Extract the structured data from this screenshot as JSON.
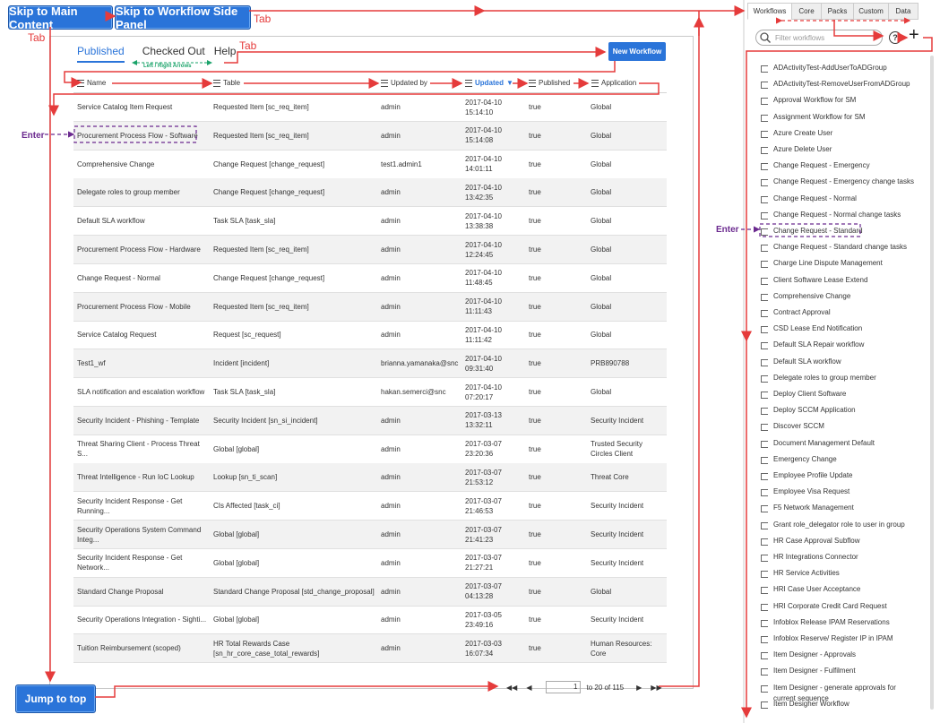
{
  "skip_links": {
    "main": "Skip to Main Content",
    "side": "Skip to Workflow Side Panel"
  },
  "annotations": {
    "tab": "Tab",
    "enter": "Enter",
    "arrows_hint": "Left / Right Arrows"
  },
  "left_tabs": [
    "Published",
    "Checked Out",
    "Help"
  ],
  "new_workflow_label": "New Workflow",
  "columns": [
    "Name",
    "Table",
    "Updated by",
    "Updated",
    "Published",
    "Application"
  ],
  "sort_indicator": "▼",
  "rows": [
    [
      "Service Catalog Item Request",
      "Requested Item [sc_req_item]",
      "admin",
      "2017-04-10\n15:14:10",
      "true",
      "Global"
    ],
    [
      "Procurement Process Flow - Software",
      "Requested Item [sc_req_item]",
      "admin",
      "2017-04-10\n15:14:08",
      "true",
      "Global"
    ],
    [
      "Comprehensive Change",
      "Change Request [change_request]",
      "test1.admin1",
      "2017-04-10\n14:01:11",
      "true",
      "Global"
    ],
    [
      "Delegate roles to group member",
      "Change Request [change_request]",
      "admin",
      "2017-04-10\n13:42:35",
      "true",
      "Global"
    ],
    [
      "Default SLA workflow",
      "Task SLA [task_sla]",
      "admin",
      "2017-04-10\n13:38:38",
      "true",
      "Global"
    ],
    [
      "Procurement Process Flow - Hardware",
      "Requested Item [sc_req_item]",
      "admin",
      "2017-04-10\n12:24:45",
      "true",
      "Global"
    ],
    [
      "Change Request - Normal",
      "Change Request [change_request]",
      "admin",
      "2017-04-10\n11:48:45",
      "true",
      "Global"
    ],
    [
      "Procurement Process Flow - Mobile",
      "Requested Item [sc_req_item]",
      "admin",
      "2017-04-10\n11:11:43",
      "true",
      "Global"
    ],
    [
      "Service Catalog Request",
      "Request [sc_request]",
      "admin",
      "2017-04-10\n11:11:42",
      "true",
      "Global"
    ],
    [
      "Test1_wf",
      "Incident [incident]",
      "brianna.yamanaka@snc",
      "2017-04-10\n09:31:40",
      "true",
      "PRB890788"
    ],
    [
      "SLA notification and escalation workflow",
      "Task SLA [task_sla]",
      "hakan.semerci@snc",
      "2017-04-10\n07:20:17",
      "true",
      "Global"
    ],
    [
      "Security Incident - Phishing - Template",
      "Security Incident [sn_si_incident]",
      "admin",
      "2017-03-13\n13:32:11",
      "true",
      "Security Incident"
    ],
    [
      "Threat Sharing Client - Process Threat\nS...",
      "Global [global]",
      "admin",
      "2017-03-07\n23:20:36",
      "true",
      "Trusted Security\nCircles Client"
    ],
    [
      "Threat Intelligence - Run IoC Lookup",
      "Lookup [sn_ti_scan]",
      "admin",
      "2017-03-07\n21:53:12",
      "true",
      "Threat Core"
    ],
    [
      "Security Incident Response - Get\nRunning...",
      "CIs Affected [task_ci]",
      "admin",
      "2017-03-07\n21:46:53",
      "true",
      "Security Incident"
    ],
    [
      "Security Operations System Command\nInteg...",
      "Global [global]",
      "admin",
      "2017-03-07\n21:41:23",
      "true",
      "Security Incident"
    ],
    [
      "Security Incident Response - Get\nNetwork...",
      "Global [global]",
      "admin",
      "2017-03-07\n21:27:21",
      "true",
      "Security Incident"
    ],
    [
      "Standard Change Proposal",
      "Standard Change Proposal [std_change_proposal]",
      "admin",
      "2017-03-07\n04:13:28",
      "true",
      "Global"
    ],
    [
      "Security Operations Integration - Sighti...",
      "Global [global]",
      "admin",
      "2017-03-05\n23:49:16",
      "true",
      "Security Incident"
    ],
    [
      "Tuition Reimbursement (scoped)",
      "HR Total Rewards Case\n[sn_hr_core_case_total_rewards]",
      "admin",
      "2017-03-03\n16:07:34",
      "true",
      "Human Resources:\nCore"
    ]
  ],
  "pager": {
    "first": "◀◀",
    "prev": "◀",
    "page_value": "1",
    "range": "to 20 of 115",
    "next": "▶",
    "last": "▶▶"
  },
  "jump_to_top": "Jump to top",
  "sidebar": {
    "tabs": [
      "Workflows",
      "Core",
      "Packs",
      "Custom",
      "Data"
    ],
    "filter_placeholder": "Filter workflows",
    "help_icon": "?",
    "add_icon": "+",
    "items": [
      "ADActivityTest-AddUserToADGroup",
      "ADActivityTest-RemoveUserFromADGroup",
      "Approval Workflow for SM",
      "Assignment Workflow for SM",
      "Azure Create User",
      "Azure Delete User",
      "Change Request - Emergency",
      "Change Request - Emergency change tasks",
      "Change Request - Normal",
      "Change Request - Normal change tasks",
      "Change Request - Standard",
      "Change Request - Standard change tasks",
      "Charge Line Dispute Management",
      "Client Software Lease Extend",
      "Comprehensive Change",
      "Contract Approval",
      "CSD Lease End Notification",
      "Default SLA Repair workflow",
      "Default SLA workflow",
      "Delegate roles to group member",
      "Deploy Client Software",
      "Deploy SCCM Application",
      "Discover SCCM",
      "Document Management Default",
      "Emergency Change",
      "Employee Profile Update",
      "Employee Visa Request",
      "F5 Network Management",
      "Grant role_delegator role to user in group",
      "HR Case Approval Subflow",
      "HR Integrations Connector",
      "HR Service Activities",
      "HRI Case User Acceptance",
      "HRI Corporate Credit Card Request",
      "Infoblox Release IPAM Reservations",
      "Infoblox Reserve/ Register IP in IPAM",
      "Item Designer - Approvals",
      "Item Designer - Fulfilment",
      "Item Designer - generate approvals for\ncurrent sequence",
      "Item Designer Workflow"
    ]
  },
  "colors": {
    "accent": "#2a74d9",
    "annotation_red": "#e53b3b",
    "annotation_purple": "#6b2a8f",
    "hint_green": "#1aa36a"
  }
}
